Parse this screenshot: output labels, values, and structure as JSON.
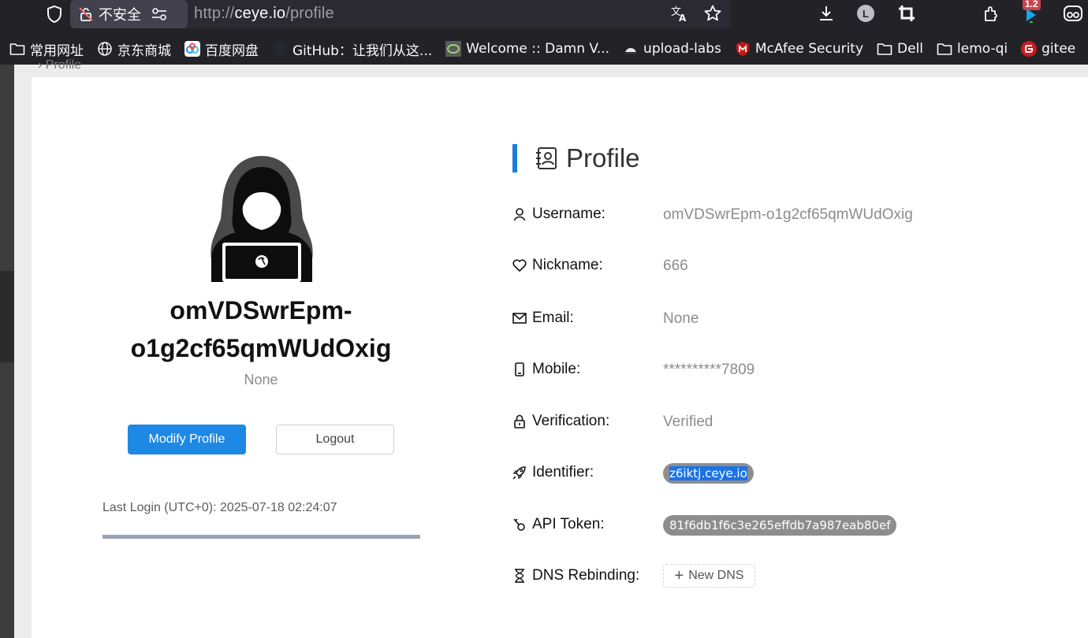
{
  "browser": {
    "security_label": "不安全",
    "url_scheme": "http://",
    "url_host": "ceye.io",
    "url_path": "/profile",
    "account_initial": "L",
    "extension_badge": "1.2"
  },
  "bookmarks": [
    {
      "label": "常用网址",
      "icon": "folder-icon"
    },
    {
      "label": "京东商城",
      "icon": "globe-icon"
    },
    {
      "label": "百度网盘",
      "icon": "baidu-cloud-icon"
    },
    {
      "label": "GitHub：让我们从这...",
      "icon": "github-icon"
    },
    {
      "label": "Welcome :: Damn V...",
      "icon": "dvwa-icon"
    },
    {
      "label": "upload-labs",
      "icon": "upload-labs-icon"
    },
    {
      "label": "McAfee Security",
      "icon": "mcafee-icon"
    },
    {
      "label": "Dell",
      "icon": "folder-icon"
    },
    {
      "label": "lemo-qi",
      "icon": "folder-icon"
    },
    {
      "label": "gitee",
      "icon": "gitee-icon"
    }
  ],
  "page": {
    "breadcrumb": "Profile"
  },
  "user_card": {
    "name_line1": "omVDSwrEpm-",
    "name_line2": "o1g2cf65qmWUdOxig",
    "subtitle": "None",
    "modify_label": "Modify Profile",
    "logout_label": "Logout",
    "last_login": "Last Login (UTC+0): 2025-07-18 02:24:07"
  },
  "profile": {
    "title": "Profile",
    "username_label": "Username:",
    "username_value": "omVDSwrEpm-o1g2cf65qmWUdOxig",
    "nickname_label": "Nickname:",
    "nickname_value": "666",
    "email_label": "Email:",
    "email_value": "None",
    "mobile_label": "Mobile:",
    "mobile_value": "**********7809",
    "verification_label": "Verification:",
    "verification_value": "Verified",
    "identifier_label": "Identifier:",
    "identifier_value": "z6iktj.ceye.io",
    "api_token_label": "API Token:",
    "api_token_value": "81f6db1f6c3e265effdb7a987eab80ef",
    "dns_rebinding_label": "DNS Rebinding:",
    "new_dns_label": "New DNS"
  },
  "colors": {
    "accent": "#1e7be0",
    "primary_button": "#1e88e5",
    "pill": "#8d8d8d"
  }
}
